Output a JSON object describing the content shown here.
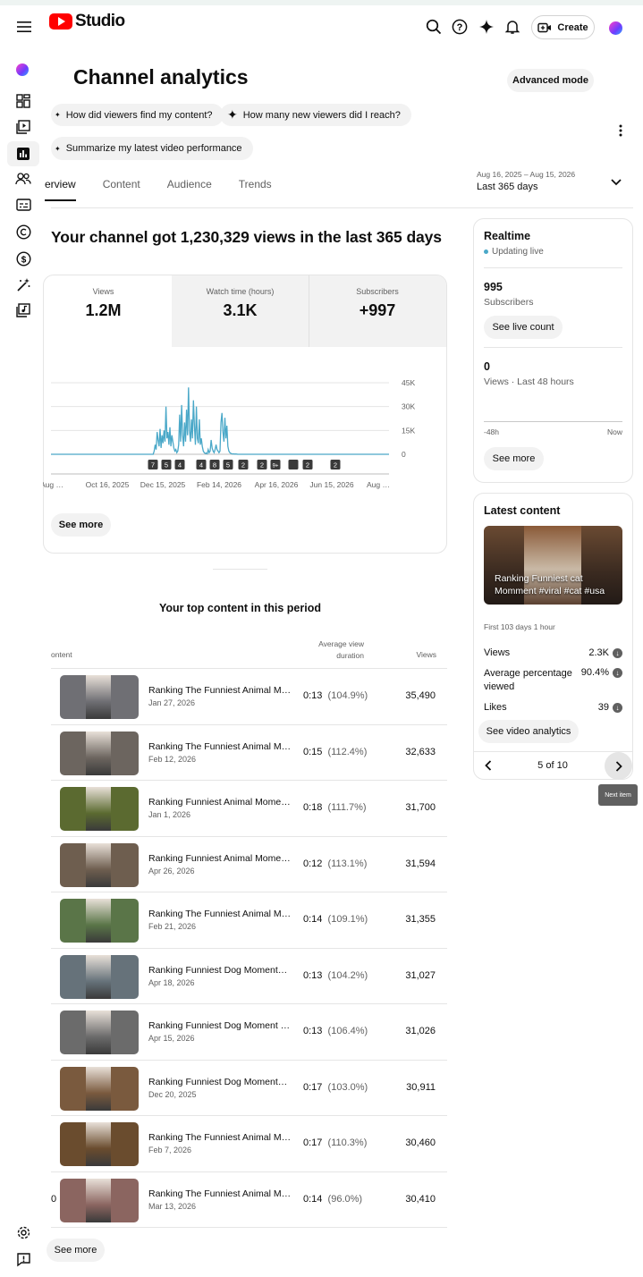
{
  "header": {
    "brand": "Studio",
    "create_label": "Create"
  },
  "page": {
    "title": "Channel analytics",
    "advanced_mode": "Advanced mode"
  },
  "prompts": [
    "How did viewers find my content?",
    "How many new viewers did I reach?",
    "Summarize my latest video performance"
  ],
  "tabs": [
    "erview",
    "Content",
    "Audience",
    "Trends"
  ],
  "date_range": {
    "range": "Aug 16, 2025 – Aug 15, 2026",
    "label": "Last 365 days"
  },
  "headline": "Your channel got 1,230,329 views in the last 365 days",
  "metrics": [
    {
      "label": "Views",
      "value": "1.2M"
    },
    {
      "label": "Watch time (hours)",
      "value": "3.1K"
    },
    {
      "label": "Subscribers",
      "value": "+997"
    }
  ],
  "chart_data": {
    "type": "line",
    "y_ticks": [
      "45K",
      "30K",
      "15K",
      "0"
    ],
    "ylim": [
      0,
      45000
    ],
    "x_ticks": [
      "Aug …",
      "Oct 16, 2025",
      "Dec 15, 2025",
      "Feb 14, 2026",
      "Apr 16, 2026",
      "Jun 15, 2026",
      "Aug …"
    ],
    "series": [
      {
        "color": "#4aa8c8",
        "values": [
          0,
          0,
          0,
          0,
          0,
          0,
          0,
          0,
          0,
          0,
          0,
          0,
          0,
          0,
          0,
          0,
          0,
          0,
          0,
          0,
          0,
          0,
          0,
          0,
          0,
          0,
          0,
          0,
          0,
          0,
          0,
          0,
          0,
          0,
          0,
          0,
          0,
          0,
          0,
          0,
          0,
          0,
          0,
          0,
          0,
          0,
          0,
          0,
          0,
          0,
          0,
          0,
          0,
          0,
          0,
          0,
          0,
          0,
          0,
          0,
          0,
          0,
          0,
          0,
          0,
          0,
          0,
          0,
          0,
          0,
          0,
          0,
          0,
          0,
          0,
          0,
          0,
          0,
          0,
          0,
          0,
          0,
          0,
          0,
          0,
          0,
          0,
          0,
          0,
          0,
          0,
          0,
          0,
          0,
          0,
          0,
          0,
          0,
          0,
          0,
          0,
          0,
          0,
          0,
          0,
          2000,
          6000,
          3000,
          14000,
          9000,
          5000,
          16000,
          4000,
          12000,
          7000,
          15000,
          8000,
          30000,
          10000,
          14000,
          6000,
          17000,
          5000,
          12000,
          8000,
          4000,
          2000,
          3000,
          1000,
          2000,
          6000,
          25000,
          8000,
          31000,
          12000,
          5000,
          20000,
          8000,
          28000,
          12000,
          42000,
          15000,
          8000,
          22000,
          10000,
          34000,
          18000,
          6000,
          30000,
          10000,
          7000,
          22000,
          6000,
          10000,
          5000,
          2000,
          1000,
          500,
          800,
          300,
          3000,
          1000,
          2000,
          9000,
          4000,
          2000,
          1000,
          3000,
          6000,
          3000,
          2000,
          1000,
          2000,
          20000,
          26000,
          14000,
          8000,
          23000,
          10000,
          18000,
          5000,
          2000,
          1000,
          600,
          300,
          200,
          300,
          100,
          200,
          100,
          0,
          0,
          0,
          0,
          0,
          0,
          0,
          0,
          0,
          0,
          0,
          0,
          0,
          0,
          0,
          0,
          0,
          0,
          0,
          0,
          0,
          0,
          0,
          0,
          0,
          0,
          0,
          0,
          0,
          0,
          0,
          0,
          0,
          0,
          0,
          0,
          0,
          0,
          0,
          0,
          0,
          0,
          0,
          0,
          0,
          0,
          0,
          0,
          0,
          0,
          0,
          0,
          0,
          0,
          0,
          0,
          0,
          0,
          0,
          0,
          0,
          0,
          0,
          0,
          0,
          0,
          0,
          0,
          0,
          0,
          0,
          0,
          0,
          0,
          0,
          0,
          0,
          0,
          0,
          0,
          0,
          0,
          0,
          0,
          0,
          0,
          0,
          0,
          0,
          0,
          0,
          0,
          0,
          0,
          0,
          0,
          0,
          0,
          0,
          0,
          0,
          0,
          0,
          0,
          0,
          0,
          0,
          0,
          0,
          0,
          0,
          0,
          0,
          0,
          0,
          0,
          0,
          0,
          0,
          0,
          0,
          0,
          0,
          0,
          0,
          0,
          0,
          0,
          0,
          0,
          0,
          0,
          0,
          0,
          0,
          0,
          0,
          0,
          0,
          0,
          0,
          0,
          0,
          0,
          0,
          0,
          0,
          0,
          0,
          0,
          0,
          0,
          0,
          0,
          0
        ]
      }
    ],
    "markers": [
      "7",
      "5",
      "4",
      "4",
      "8",
      "5",
      "2",
      "2",
      "9+",
      "",
      "2",
      "2"
    ]
  },
  "overview_see_more": "See more",
  "top_content": {
    "title": "Your top content in this period",
    "col_content": "ontent",
    "col_duration": "Average view duration",
    "col_views": "Views",
    "rows": [
      {
        "title": "Ranking The Funniest Animal Mo...",
        "date": "Jan 27, 2026",
        "dur": "0:13",
        "pct": "(104.9%)",
        "views": "35,490",
        "color": "#6f6f74",
        "prefix": ""
      },
      {
        "title": "Ranking The Funniest Animal Mo...",
        "date": "Feb 12, 2026",
        "dur": "0:15",
        "pct": "(112.4%)",
        "views": "32,633",
        "color": "#6c655f",
        "prefix": ""
      },
      {
        "title": "Ranking Funniest Animal Momen...",
        "date": "Jan 1, 2026",
        "dur": "0:18",
        "pct": "(111.7%)",
        "views": "31,700",
        "color": "#5b6a30",
        "prefix": ""
      },
      {
        "title": "Ranking Funniest Animal Momen...",
        "date": "Apr 26, 2026",
        "dur": "0:12",
        "pct": "(113.1%)",
        "views": "31,594",
        "color": "#6e5e4f",
        "prefix": ""
      },
      {
        "title": "Ranking The Funniest Animal Mo...",
        "date": "Feb 21, 2026",
        "dur": "0:14",
        "pct": "(109.1%)",
        "views": "31,355",
        "color": "#5a7548",
        "prefix": ""
      },
      {
        "title": "Ranking Funniest Dog Moments#...",
        "date": "Apr 18, 2026",
        "dur": "0:13",
        "pct": "(104.2%)",
        "views": "31,027",
        "color": "#66727a",
        "prefix": ""
      },
      {
        "title": "Ranking Funniest Dog Moment #...",
        "date": "Apr 15, 2026",
        "dur": "0:13",
        "pct": "(106.4%)",
        "views": "31,026",
        "color": "#6b6b6b",
        "prefix": ""
      },
      {
        "title": "Ranking Funniest Dog Moments ...",
        "date": "Dec 20, 2025",
        "dur": "0:17",
        "pct": "(103.0%)",
        "views": "30,911",
        "color": "#7a5a3e",
        "prefix": ""
      },
      {
        "title": "Ranking The Funniest Animal Mo...",
        "date": "Feb 7, 2026",
        "dur": "0:17",
        "pct": "(110.3%)",
        "views": "30,460",
        "color": "#6a4c2e",
        "prefix": ""
      },
      {
        "title": "Ranking The Funniest Animal Mo...",
        "date": "Mar 13, 2026",
        "dur": "0:14",
        "pct": "(96.0%)",
        "views": "30,410",
        "color": "#8b6560",
        "prefix": "0"
      }
    ],
    "see_more": "See more"
  },
  "realtime": {
    "title": "Realtime",
    "status": "Updating live",
    "subs_value": "995",
    "subs_label": "Subscribers",
    "live_count_btn": "See live count",
    "views_value": "0",
    "views_label": "Views · Last 48 hours",
    "axis_left": "-48h",
    "axis_right": "Now",
    "see_more": "See more"
  },
  "latest": {
    "title": "Latest content",
    "video_title": "Ranking Funniest cat Momment #viral #cat #usa",
    "age": "First 103 days 1 hour",
    "stats": [
      {
        "label": "Views",
        "value": "2.3K"
      },
      {
        "label": "Average percentage viewed",
        "value": "90.4%"
      },
      {
        "label": "Likes",
        "value": "39"
      }
    ],
    "analytics_btn": "See video analytics",
    "pager": "5 of 10",
    "tooltip": "Next item"
  },
  "colors": {
    "accent_line": "#4aa8c8",
    "brand_red": "#ff0000",
    "live_dot": "#4aa8c8"
  }
}
